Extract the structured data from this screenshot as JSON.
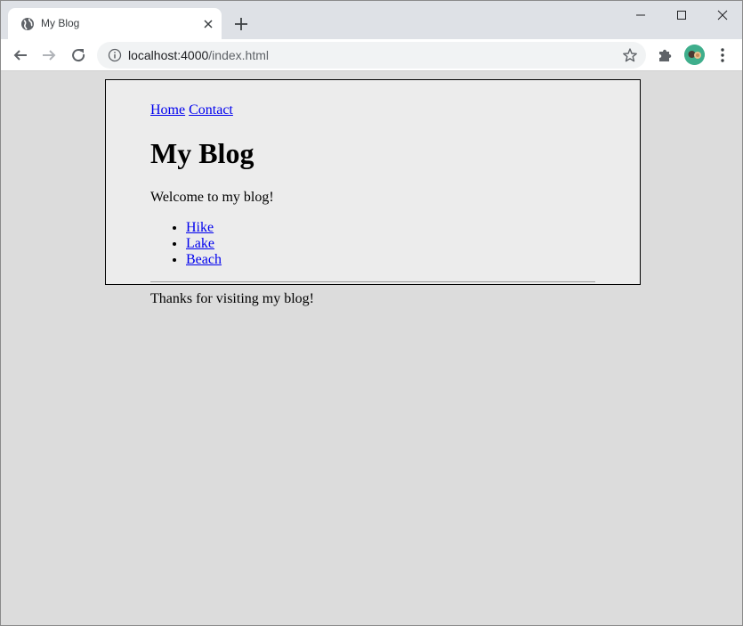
{
  "browser": {
    "tab": {
      "title": "My Blog",
      "favicon": "globe-icon"
    },
    "address_bar": {
      "host": "localhost:4000",
      "path": "/index.html"
    }
  },
  "page": {
    "nav": {
      "home_label": "Home",
      "contact_label": "Contact"
    },
    "title": "My Blog",
    "welcome_text": "Welcome to my blog!",
    "posts": [
      {
        "label": "Hike"
      },
      {
        "label": "Lake"
      },
      {
        "label": "Beach"
      }
    ],
    "footer_text": "Thanks for visiting my blog!"
  },
  "colors": {
    "tabstrip_bg": "#dee1e6",
    "page_bg": "#dcdcdc",
    "content_bg": "#ececec",
    "link": "#0000ee",
    "avatar": "#3fae8c"
  }
}
